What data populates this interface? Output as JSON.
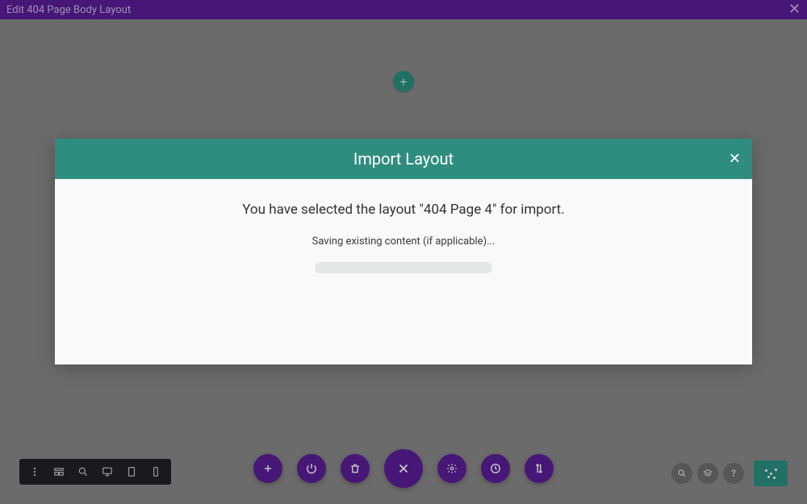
{
  "top_bar": {
    "title": "Edit 404 Page Body Layout"
  },
  "modal": {
    "title": "Import Layout",
    "headline": "You have selected the layout \"404 Page 4\" for import.",
    "status": "Saving existing content (if applicable)..."
  },
  "colors": {
    "purple": "#5b1e99",
    "teal": "#2b9082",
    "teal_header": "#2f8d80",
    "canvas_gray": "#898989",
    "toolbar_dark": "#202227"
  }
}
